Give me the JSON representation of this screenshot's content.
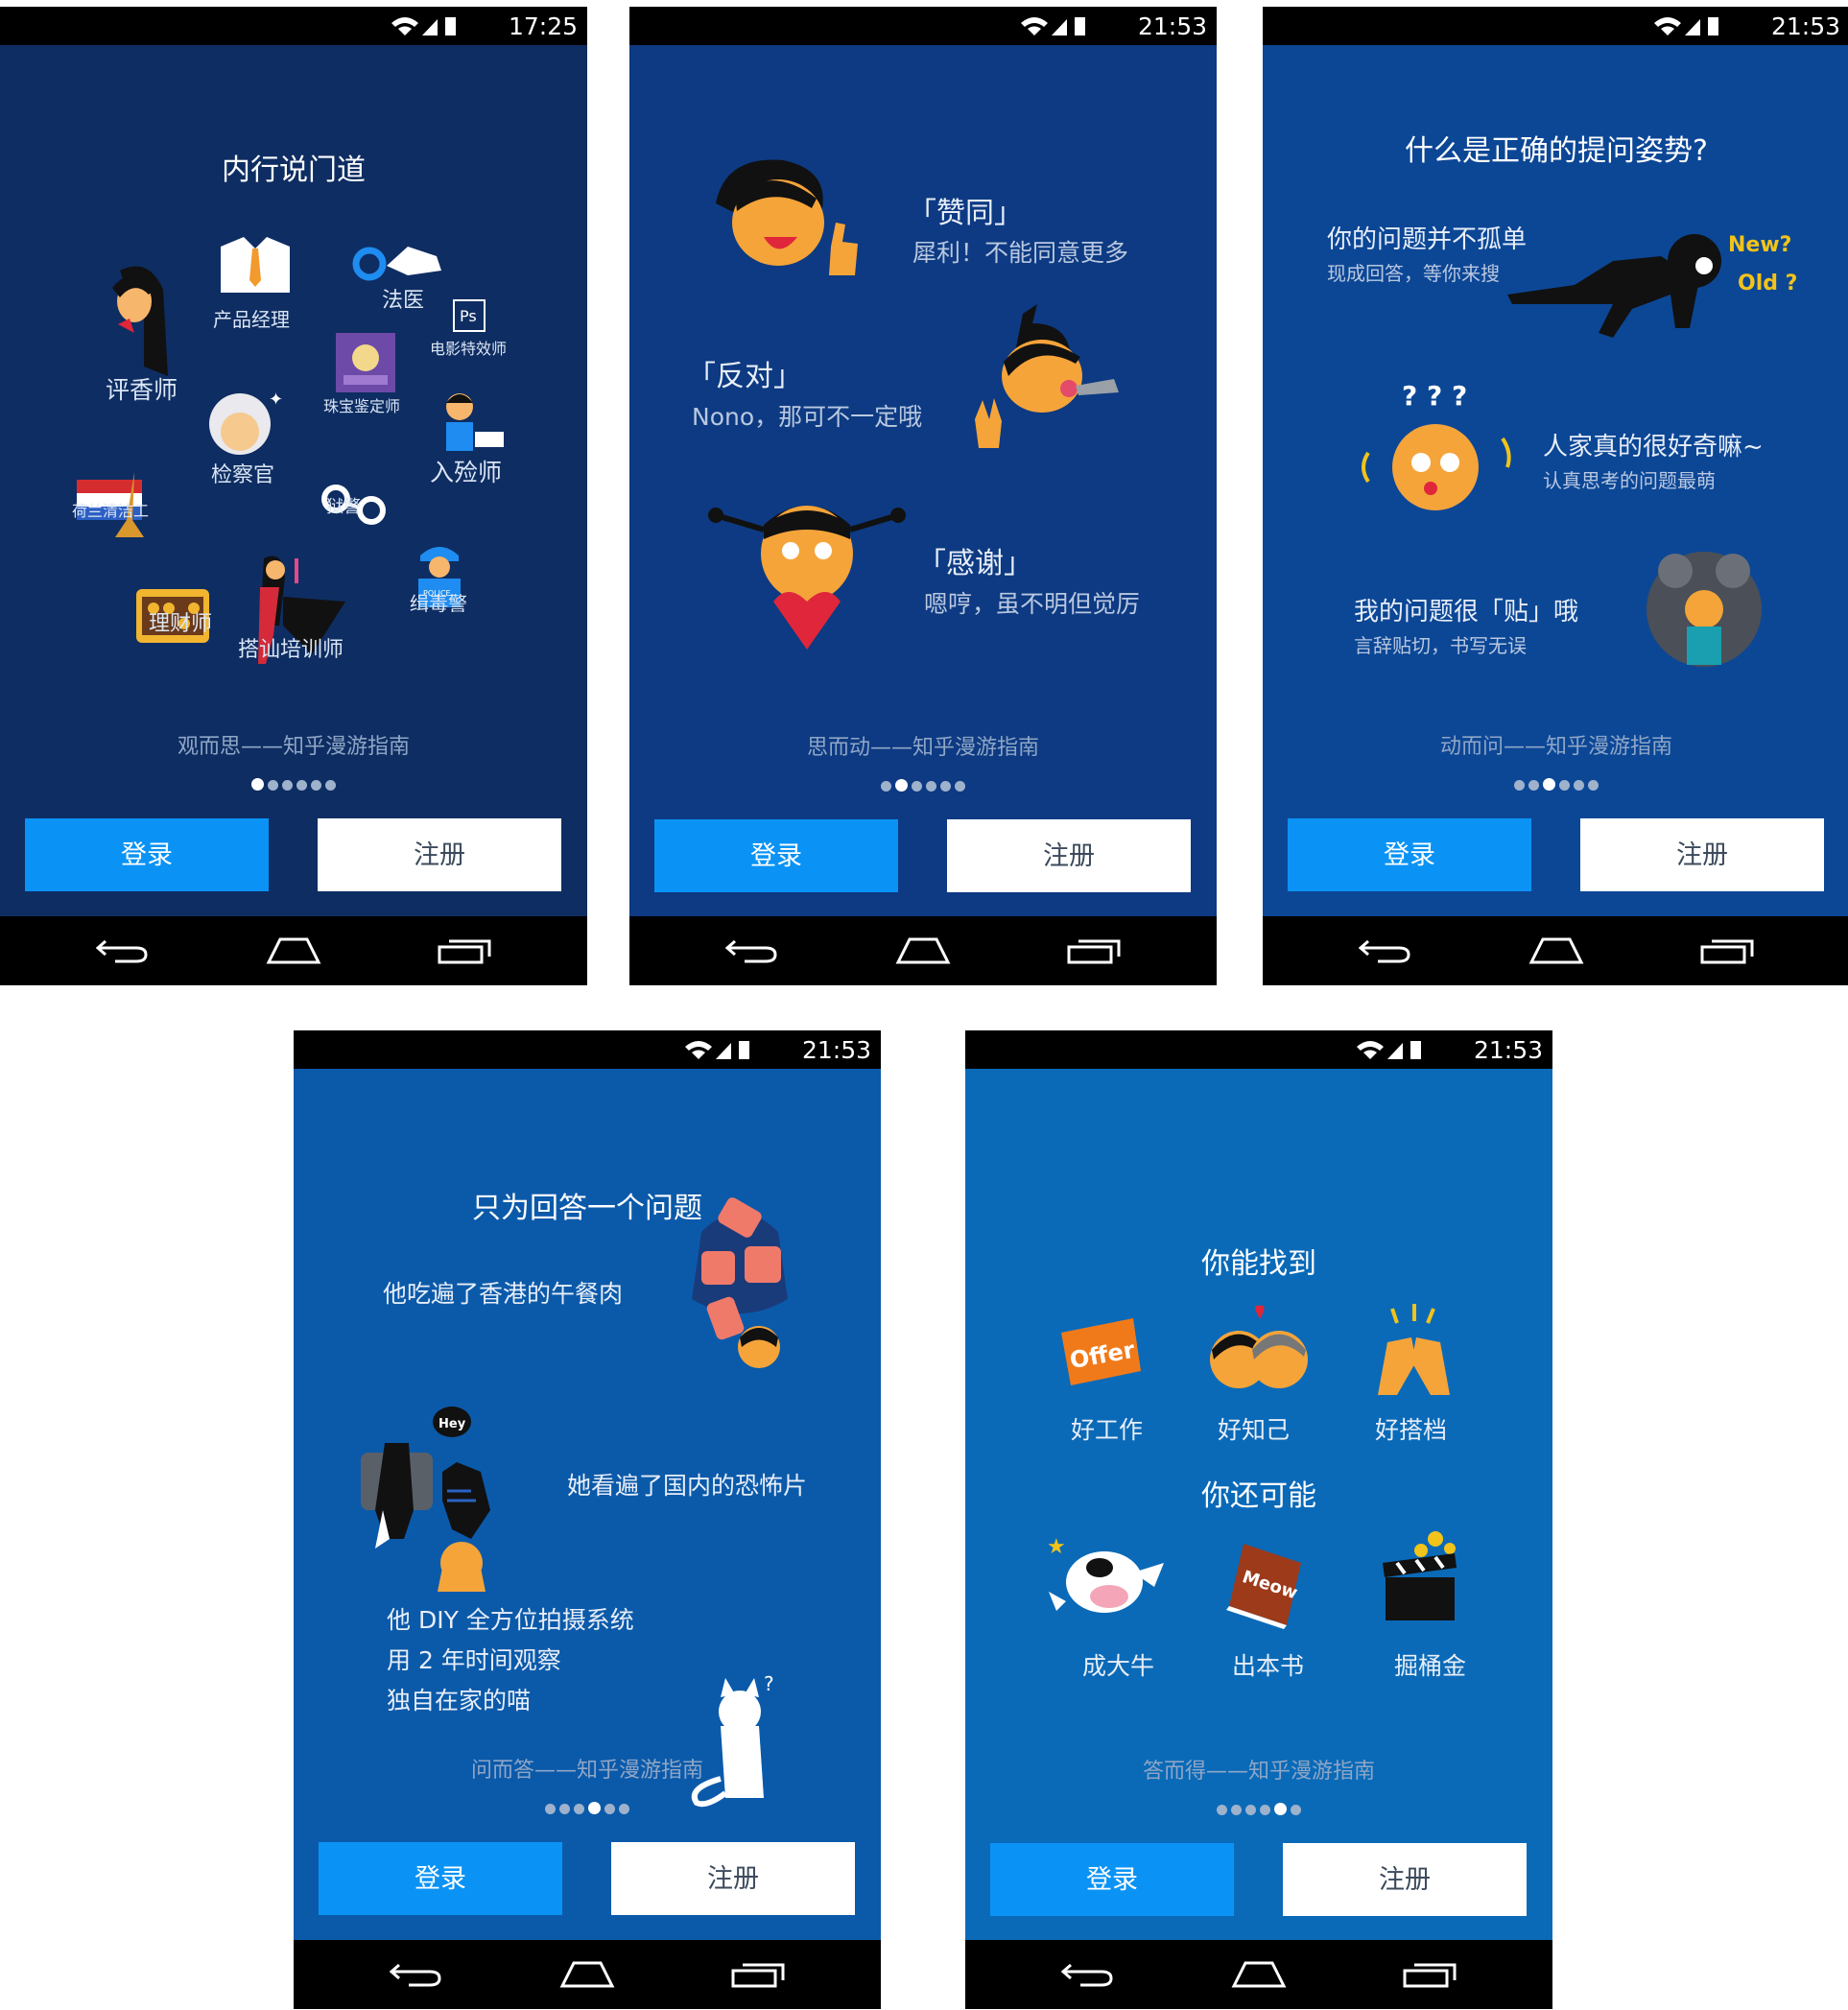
{
  "common": {
    "login_label": "登录",
    "register_label": "注册",
    "colors": {
      "login_button": "#0a93f5",
      "register_button": "#ffffff",
      "status_bar": "#000000"
    },
    "icons": [
      "wifi-icon",
      "signal-icon",
      "battery-icon",
      "back-icon",
      "home-icon",
      "recents-icon"
    ]
  },
  "screens": [
    {
      "time": "17:25",
      "title": "内行说门道",
      "caption": "观而思——知乎漫游指南",
      "page_index": 1,
      "page_count": 6,
      "background": "#0e2d62",
      "professions": [
        "评香师",
        "产品经理",
        "法医",
        "电影特效师",
        "珠宝鉴定师",
        "检察官",
        "入殓师",
        "荷兰清洁工",
        "狱警",
        "缉毒警",
        "理财师",
        "搭讪培训师"
      ],
      "icon_labels": {
        "ps": "Ps",
        "police": "POLICE"
      }
    },
    {
      "time": "21:53",
      "caption": "思而动——知乎漫游指南",
      "page_index": 2,
      "page_count": 6,
      "background": "#0d3a82",
      "items": [
        {
          "title": "「赞同」",
          "sub": "犀利！不能同意更多"
        },
        {
          "title": "「反对」",
          "sub": "Nono，那可不一定哦"
        },
        {
          "title": "「感谢」",
          "sub": "嗯哼，虽不明但觉厉"
        }
      ]
    },
    {
      "time": "21:53",
      "title": "什么是正确的提问姿势?",
      "caption": "动而问——知乎漫游指南",
      "page_index": 3,
      "page_count": 6,
      "background": "#0c4796",
      "items": [
        {
          "title": "你的问题并不孤单",
          "sub": "现成回答，等你来搜"
        },
        {
          "title": "人家真的很好奇嘛~",
          "sub": "认真思考的问题最萌"
        },
        {
          "title": "我的问题很「贴」哦",
          "sub": "言辞贴切，书写无误"
        }
      ],
      "stickers": {
        "new": "New?",
        "old": "Old ?",
        "qmarks": "? ? ?"
      }
    },
    {
      "time": "21:53",
      "title": "只为回答一个问题",
      "caption": "问而答——知乎漫游指南",
      "page_index": 4,
      "page_count": 6,
      "background": "#0b5aaa",
      "items": [
        {
          "text": "他吃遍了香港的午餐肉"
        },
        {
          "text": "她看遍了国内的恐怖片"
        },
        {
          "line1": "他 DIY 全方位拍摄系统",
          "line2": "用 2 年时间观察",
          "line3": "独自在家的喵"
        }
      ],
      "bubble": "Hey",
      "cat_mark": "?"
    },
    {
      "time": "21:53",
      "title": "你能找到",
      "title2": "你还可能",
      "caption": "答而得——知乎漫游指南",
      "page_index": 5,
      "page_count": 6,
      "background": "#0a6ab8",
      "find": [
        "好工作",
        "好知己",
        "好搭档"
      ],
      "maybe": [
        "成大牛",
        "出本书",
        "掘桶金"
      ],
      "offer_text": "Offer",
      "book_text": "Meow"
    }
  ]
}
